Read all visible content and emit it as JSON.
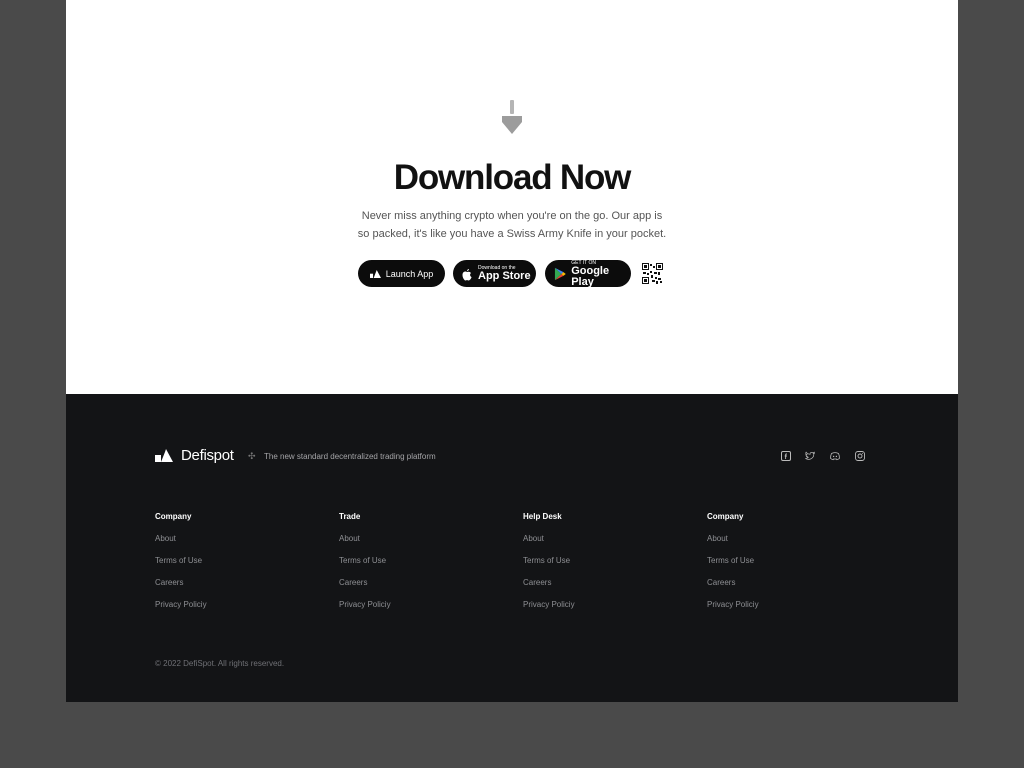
{
  "hero": {
    "title": "Download Now",
    "description_line1": "Never miss anything crypto when you're on the go. Our app is",
    "description_line2": "so packed, it's like you have a Swiss Army Knife in your pocket.",
    "icon": "shovel-icon"
  },
  "buttons": {
    "launch_label": "Launch App",
    "appstore_small": "Download on the",
    "appstore_big": "App Store",
    "gplay_small": "GET IT ON",
    "gplay_big": "Google Play"
  },
  "footer": {
    "brand_name": "Defispot",
    "separator": "✣",
    "tagline": "The new standard decentralized trading platform",
    "social_icons": [
      "facebook-icon",
      "twitter-icon",
      "discord-icon",
      "instagram-icon"
    ],
    "columns": [
      {
        "title": "Company",
        "links": [
          "About",
          "Terms of Use",
          "Careers",
          "Privacy Policiy"
        ]
      },
      {
        "title": "Trade",
        "links": [
          "About",
          "Terms of Use",
          "Careers",
          "Privacy Policiy"
        ]
      },
      {
        "title": "Help Desk",
        "links": [
          "About",
          "Terms of Use",
          "Careers",
          "Privacy Policiy"
        ]
      },
      {
        "title": "Company",
        "links": [
          "About",
          "Terms of Use",
          "Careers",
          "Privacy Policiy"
        ]
      }
    ],
    "copyright": "© 2022 DefiSpot. All rights reserved."
  },
  "colors": {
    "background": "#4a4a4a",
    "hero_bg": "#ffffff",
    "footer_bg": "#131416",
    "button_bg": "#0c0c0c"
  }
}
